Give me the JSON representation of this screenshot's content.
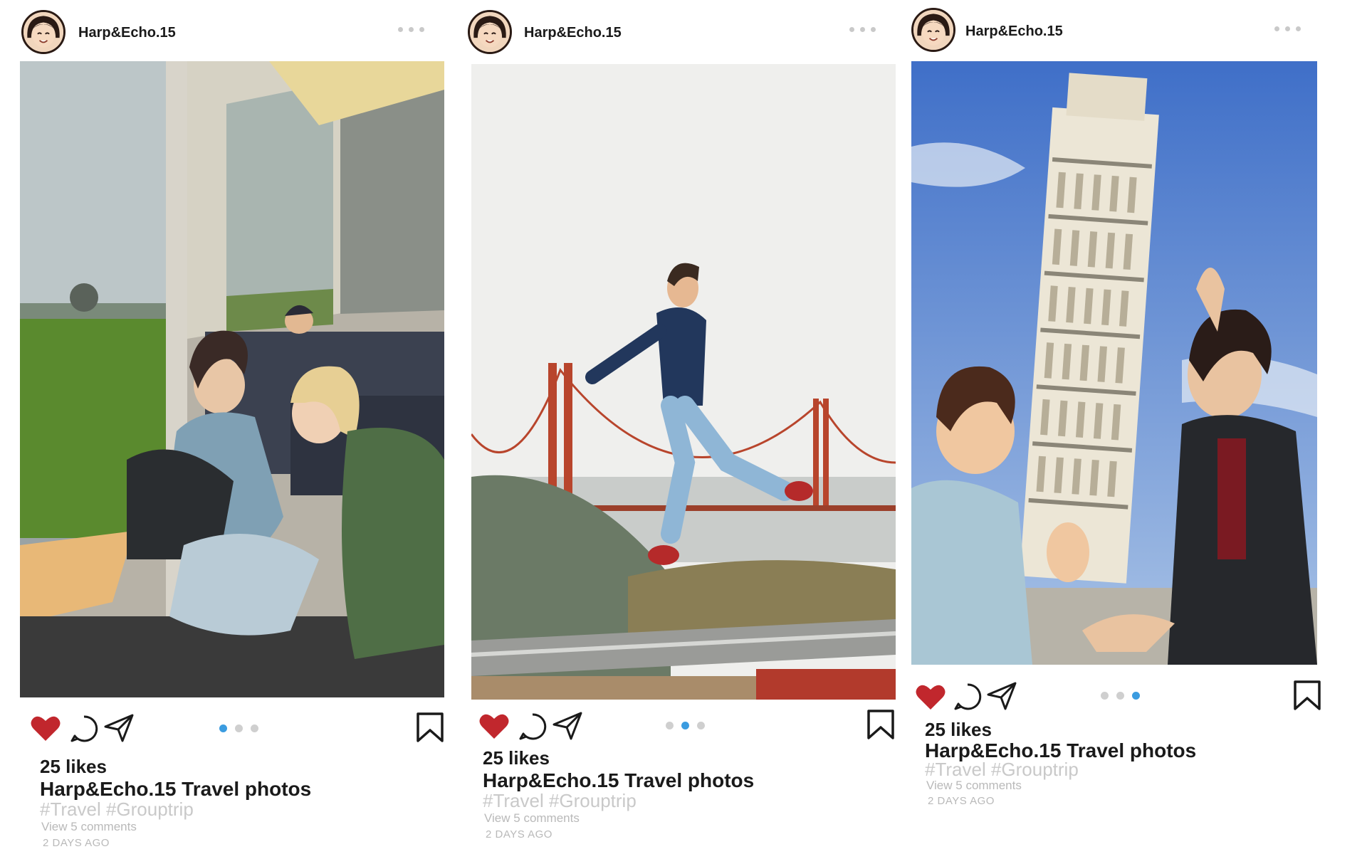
{
  "posts": [
    {
      "username": "Harp&Echo.15",
      "likes": "25 likes",
      "caption": "Harp&Echo.15 Travel photos",
      "tags": "#Travel #Grouptrip",
      "comments": "View 5 comments",
      "time": "2 DAYS AGO",
      "active_slide": 1
    },
    {
      "username": "Harp&Echo.15",
      "likes": "25 likes",
      "caption": "Harp&Echo.15 Travel photos",
      "tags": "#Travel #Grouptrip",
      "comments": "View 5 comments",
      "time": "2 DAYS AGO",
      "active_slide": 2
    },
    {
      "username": "Harp&Echo.15",
      "likes": "25 likes",
      "caption": "Harp&Echo.15 Travel photos",
      "tags": "#Travel #Grouptrip",
      "comments": "View 5 comments",
      "time": "2 DAYS AGO",
      "active_slide": 3
    }
  ],
  "icons": {
    "like": "heart-icon",
    "comment": "comment-icon",
    "share": "paper-plane-icon",
    "save": "bookmark-icon",
    "more": "more-dots-icon"
  },
  "colors": {
    "heart": "#c1272d",
    "active_dot": "#3b9ce0",
    "inactive_dot": "#cfcfcf",
    "hashtag": "#c9c9c9"
  }
}
